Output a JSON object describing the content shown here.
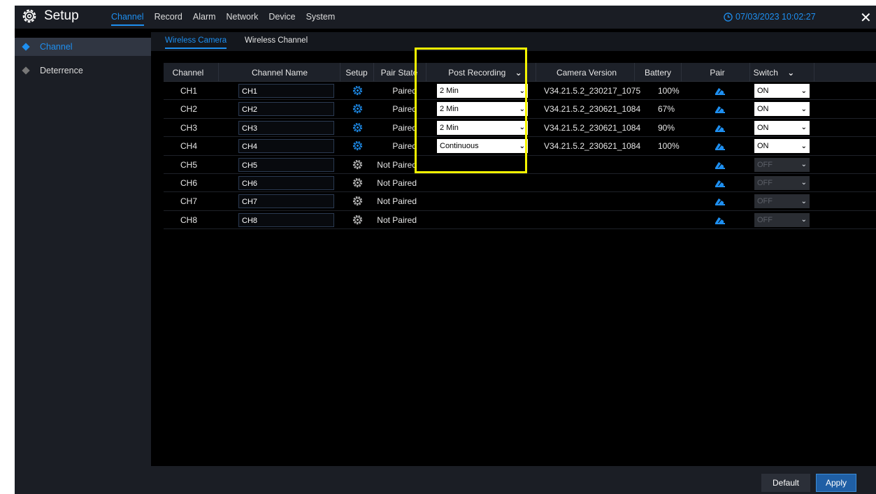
{
  "header": {
    "title": "Setup",
    "nav": [
      "Channel",
      "Record",
      "Alarm",
      "Network",
      "Device",
      "System"
    ],
    "active_nav": "Channel",
    "datetime": "07/03/2023 10:02:27"
  },
  "sidebar": {
    "items": [
      {
        "label": "Channel",
        "active": true
      },
      {
        "label": "Deterrence",
        "active": false
      }
    ]
  },
  "subtabs": [
    {
      "label": "Wireless Camera",
      "active": true
    },
    {
      "label": "Wireless Channel",
      "active": false
    }
  ],
  "table": {
    "headers": [
      "Channel",
      "Channel Name",
      "Setup",
      "Pair State",
      "Post Recording",
      "Camera Version",
      "Battery",
      "Pair",
      "Switch"
    ],
    "rows": [
      {
        "channel": "CH1",
        "name": "CH1",
        "pair_state": "Paired",
        "post_recording": "2 Min",
        "version": "V34.21.5.2_230217_1075",
        "battery": "100%",
        "switch": "ON",
        "enabled": true
      },
      {
        "channel": "CH2",
        "name": "CH2",
        "pair_state": "Paired",
        "post_recording": "2 Min",
        "version": "V34.21.5.2_230621_1084",
        "battery": "67%",
        "switch": "ON",
        "enabled": true
      },
      {
        "channel": "CH3",
        "name": "CH3",
        "pair_state": "Paired",
        "post_recording": "2 Min",
        "version": "V34.21.5.2_230621_1084",
        "battery": "90%",
        "switch": "ON",
        "enabled": true
      },
      {
        "channel": "CH4",
        "name": "CH4",
        "pair_state": "Paired",
        "post_recording": "Continuous",
        "version": "V34.21.5.2_230621_1084",
        "battery": "100%",
        "switch": "ON",
        "enabled": true
      },
      {
        "channel": "CH5",
        "name": "CH5",
        "pair_state": "Not Paired",
        "post_recording": "",
        "version": "",
        "battery": "",
        "switch": "OFF",
        "enabled": false
      },
      {
        "channel": "CH6",
        "name": "CH6",
        "pair_state": "Not Paired",
        "post_recording": "",
        "version": "",
        "battery": "",
        "switch": "OFF",
        "enabled": false
      },
      {
        "channel": "CH7",
        "name": "CH7",
        "pair_state": "Not Paired",
        "post_recording": "",
        "version": "",
        "battery": "",
        "switch": "OFF",
        "enabled": false
      },
      {
        "channel": "CH8",
        "name": "CH8",
        "pair_state": "Not Paired",
        "post_recording": "",
        "version": "",
        "battery": "",
        "switch": "OFF",
        "enabled": false
      }
    ]
  },
  "footer": {
    "default_label": "Default",
    "apply_label": "Apply"
  },
  "colors": {
    "accent": "#1e8ff0",
    "highlight": "#f5f500",
    "background": "#000000",
    "panel": "#1b1e25"
  },
  "icons": {
    "logo": "gear-icon",
    "clock": "clock-icon",
    "close": "close-icon",
    "setup": "gear-icon",
    "pair": "camera-pair-icon",
    "dropdown": "chevron-down-icon"
  }
}
